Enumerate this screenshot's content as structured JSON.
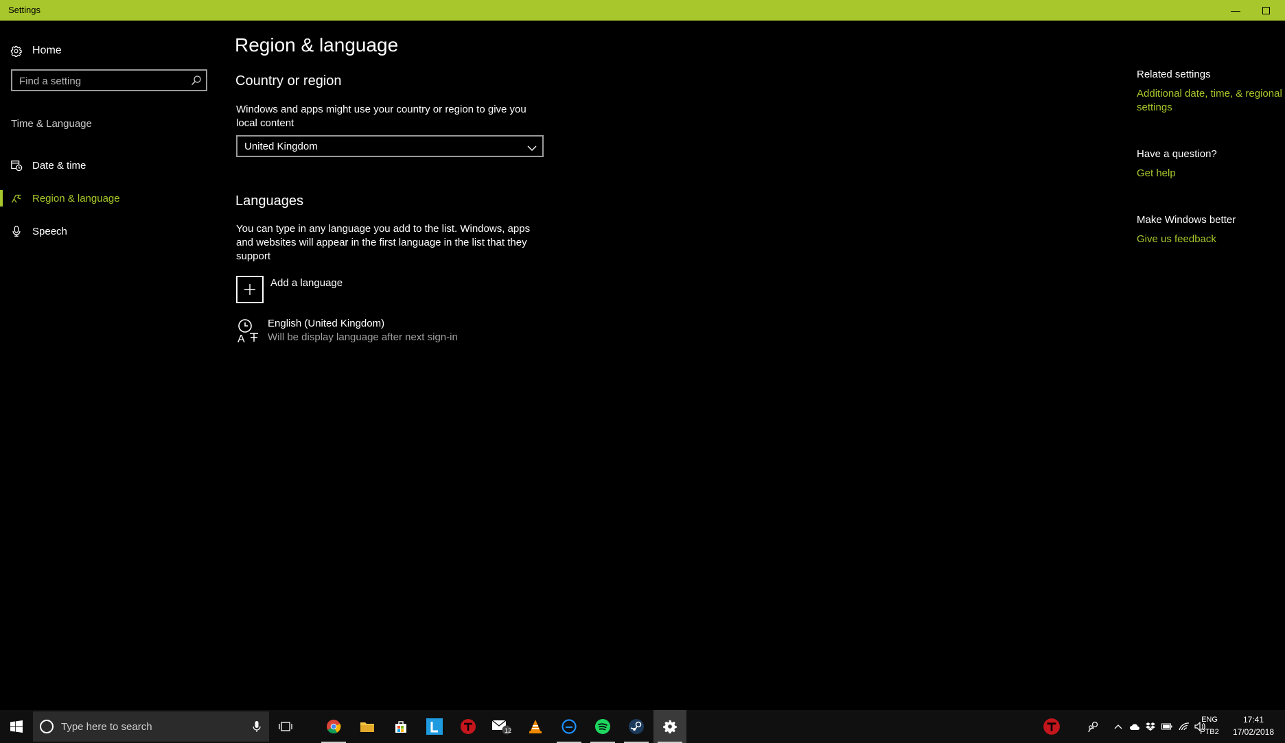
{
  "window": {
    "title": "Settings"
  },
  "sidebar": {
    "home": "Home",
    "search_placeholder": "Find a setting",
    "section": "Time & Language",
    "items": [
      {
        "label": "Date & time",
        "icon": "calendar-clock-icon"
      },
      {
        "label": "Region & language",
        "icon": "region-language-icon",
        "active": true
      },
      {
        "label": "Speech",
        "icon": "microphone-icon"
      }
    ]
  },
  "main": {
    "title": "Region & language",
    "country": {
      "heading": "Country or region",
      "description": "Windows and apps might use your country or region to give you local content",
      "selected": "United Kingdom"
    },
    "languages": {
      "heading": "Languages",
      "description": "You can type in any language you add to the list. Windows, apps and websites will appear in the first language in the list that they support",
      "add_label": "Add a language",
      "items": [
        {
          "name": "English (United Kingdom)",
          "status": "Will be display language after next sign-in"
        }
      ]
    }
  },
  "related": {
    "heading": "Related settings",
    "link": "Additional date, time, & regional settings",
    "question_heading": "Have a question?",
    "help_link": "Get help",
    "better_heading": "Make Windows better",
    "feedback_link": "Give us feedback"
  },
  "taskbar": {
    "search_placeholder": "Type here to search",
    "mail_badge": "12",
    "lang_line1": "ENG",
    "lang_line2": "PTB2",
    "time": "17:41",
    "date": "17/02/2018"
  },
  "colors": {
    "accent": "#a7c72c",
    "background": "#000000",
    "taskbar": "#101010"
  }
}
